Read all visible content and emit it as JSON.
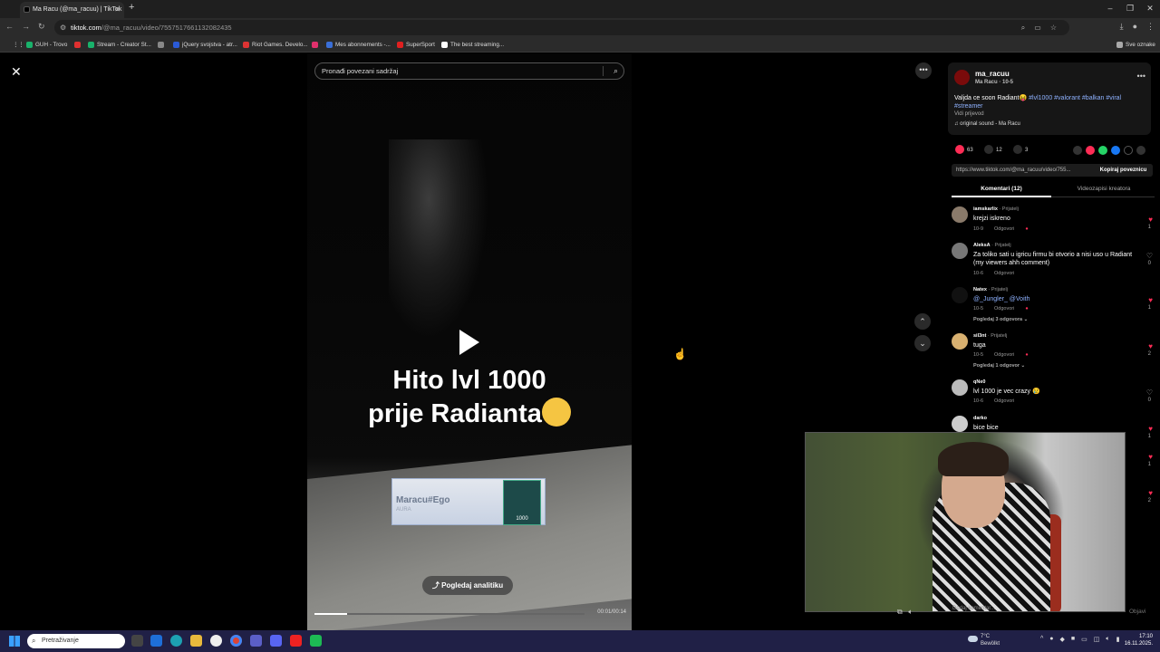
{
  "browser": {
    "tab_title": "Ma Racu (@ma_racuu) | TikTok",
    "new_tab": "+",
    "url_host": "tiktok.com",
    "url_path": "/@ma_racuu/video/7557517661132082435",
    "window_controls": [
      "–",
      "❐",
      "✕"
    ],
    "bookmarks": [
      {
        "label": "GUH - Trovo",
        "color": "#19b26b"
      },
      {
        "label": "",
        "color": "#e03030"
      },
      {
        "label": "Stream - Creator St...",
        "color": "#19b26b"
      },
      {
        "label": "",
        "color": "#888888"
      },
      {
        "label": "jQuery svojstva - atr...",
        "color": "#2a5ad6"
      },
      {
        "label": "Riot Games. Develo...",
        "color": "#d33"
      },
      {
        "label": "",
        "color": "#e1306c"
      },
      {
        "label": "Mes abonnements -...",
        "color": "#3a6fd8"
      },
      {
        "label": "SuperSport",
        "color": "#e02020"
      },
      {
        "label": "The best streaming...",
        "color": "#ffffff"
      }
    ],
    "all_bookmarks": "Sve oznake"
  },
  "video": {
    "search_placeholder": "Pronađi povezani sadržaj",
    "caption_line1": "Hito lvl 1000",
    "caption_line2": "prije Radianta",
    "card_name": "Maracu#Ego",
    "card_sub": "AURA",
    "badge_level": "1000",
    "analytics_label": "Pogledaj analitiku",
    "time": "00:01/00:14",
    "progress": 0.12
  },
  "post": {
    "author": "ma_racuu",
    "author_sub": "Ma Racu · 10-5",
    "description": "Valjda ce soon Radiant😝 ",
    "hashtags": "#lvl1000 #valorant #balkan #viral #streamer",
    "see_translation": "Vidi prijevod",
    "sound": "♫  original sound - Ma Racu",
    "likes": "63",
    "comments_count": "12",
    "saves": "3",
    "share_link": "https://www.tiktok.com/@ma_racuu/video/755...",
    "copy_link": "Kopiraj poveznicu",
    "tab_comments": "Komentari (12)",
    "tab_creator": "Videozapisi kreatora"
  },
  "comments": [
    {
      "user": "iamskarlix",
      "tag": " · Prijatelj",
      "text": "krejzi iskreno",
      "date": "10-9",
      "reply": "Odgovori",
      "likes": "1",
      "liked": true,
      "avatar": "#8a7a6a"
    },
    {
      "user": "AleksA",
      "tag": " · Prijatelj",
      "text": "Za toliko sati u igricu firmu bi otvorio a nisi uso u Radiant (my viewers ahh comment)",
      "date": "10-6",
      "reply": "Odgovori",
      "likes": "0",
      "liked": false,
      "avatar": "#777777"
    },
    {
      "user": "Natex",
      "tag": " · Prijatelj",
      "text": "@_Jungler_ @Voith",
      "date": "10-5",
      "reply": "Odgovori",
      "likes": "1",
      "liked": true,
      "avatar": "#111111",
      "views": "Pogledaj 3 odgovora ⌄"
    },
    {
      "user": "sil3nt",
      "tag": " · Prijatelj",
      "text": "tuga",
      "date": "10-5",
      "reply": "Odgovori",
      "likes": "2",
      "liked": true,
      "avatar": "#d8b070",
      "views": "Pogledaj 1 odgovor ⌄"
    },
    {
      "user": "qNe0",
      "tag": "",
      "text": "lvl 1000 je vec crazy 😢",
      "date": "10-6",
      "reply": "Odgovori",
      "likes": "0",
      "liked": false,
      "avatar": "#bbbbbb"
    },
    {
      "user": "darko",
      "tag": "",
      "text": "bice bice",
      "date": "",
      "reply": "",
      "likes": "1",
      "liked": true,
      "avatar": "#cccccc"
    }
  ],
  "hidden_hearts": [
    {
      "likes": "1"
    },
    {
      "likes": "2"
    }
  ],
  "footer": {
    "reply_placeholder": "Dodaj komentar...",
    "post_button": "Objavi"
  },
  "taskbar": {
    "search_placeholder": "Pretraživanje",
    "weather_temp": "7°C",
    "weather_desc": "Bewölkt",
    "time": "17:10",
    "date": "16.11.2025."
  },
  "colors": {
    "accent_red": "#fe2c55",
    "hashtag_blue": "#8fb2ff",
    "taskbar": "#202046"
  }
}
